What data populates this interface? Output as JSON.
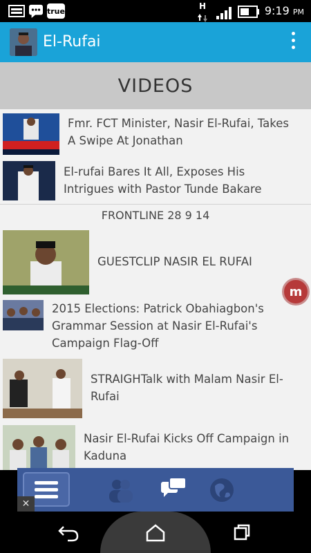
{
  "status_bar": {
    "time": "9:19",
    "ampm": "PM",
    "notification_badge": "true",
    "network_label": "H"
  },
  "app_bar": {
    "title": "El-Rufai"
  },
  "section": {
    "title": "VIDEOS"
  },
  "videos": [
    {
      "title_line1": "Fmr. FCT Minister, Nasir El-Rufai, Takes",
      "title_line2": "A Swipe At Jonathan",
      "title_line3": ""
    },
    {
      "title_line1": "El-rufai Bares It All, Exposes His",
      "title_line2": "Intrigues with Pastor Tunde Bakare",
      "title_line3": ""
    },
    {
      "title_line1": "FRONTLINE 28 9 14",
      "title_line2": "",
      "title_line3": ""
    },
    {
      "title_line1": "GUESTCLIP NASIR EL RUFAI",
      "title_line2": "",
      "title_line3": ""
    },
    {
      "title_line1": "2015 Elections: Patrick Obahiagbon's",
      "title_line2": "Grammar Session at Nasir El-Rufai's",
      "title_line3": "Campaign Flag-Off"
    },
    {
      "title_line1": "STRAIGHTalk with Malam Nasir El-",
      "title_line2": "Rufai",
      "title_line3": ""
    },
    {
      "title_line1": "Nasir El-Rufai Kicks Off Campaign in",
      "title_line2": "Kaduna",
      "title_line3": ""
    }
  ],
  "floating_badge": {
    "letter": "m"
  },
  "ad_bar": {
    "close": "✕",
    "icons": [
      "menu-icon",
      "friends-icon",
      "messages-icon",
      "globe-icon"
    ]
  },
  "colors": {
    "app_bar": "#1aa3d8",
    "section_header": "#c8c8c8",
    "list_bg": "#f2f2f2",
    "ad_bar": "#3b5998"
  }
}
